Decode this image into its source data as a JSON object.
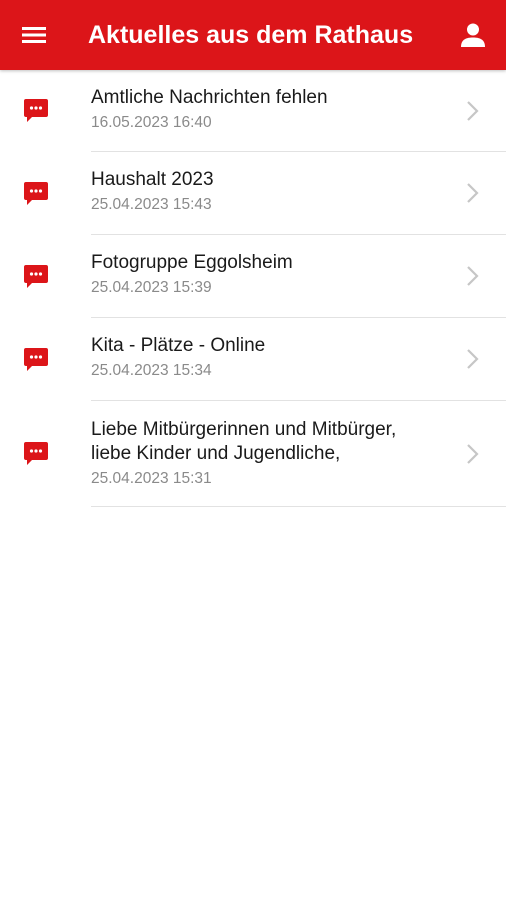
{
  "header": {
    "title": "Aktuelles aus dem Rathaus",
    "menu_icon": "hamburger-menu-icon",
    "profile_icon": "user-profile-icon",
    "background_color": "#dc1519"
  },
  "news": [
    {
      "title": "Amtliche Nachrichten fehlen",
      "date": "16.05.2023 16:40"
    },
    {
      "title": "Haushalt 2023",
      "date": "25.04.2023 15:43"
    },
    {
      "title": "Fotogruppe Eggolsheim",
      "date": "25.04.2023 15:39"
    },
    {
      "title": "Kita - Plätze - Online",
      "date": "25.04.2023 15:34"
    },
    {
      "title": "Liebe Mitbürgerinnen und Mitbürger,\nliebe Kinder und Jugendliche,",
      "date": "25.04.2023 15:31"
    }
  ],
  "item_icon": "message-bubble-icon",
  "chevron_icon": "chevron-right-icon",
  "accent_color": "#dc1519"
}
